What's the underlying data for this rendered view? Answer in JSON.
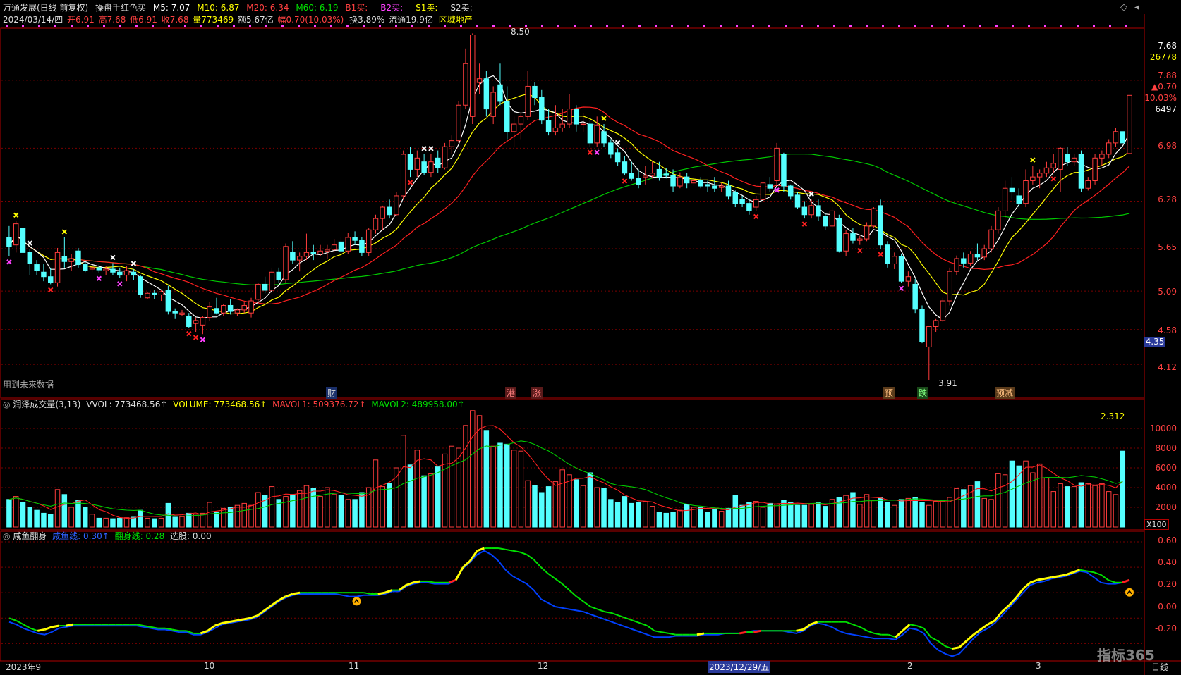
{
  "header": {
    "stock": "万通发展(日线 前复权)",
    "indicator": "操盘手红色买",
    "m5": "M5: 7.07",
    "m10": "M10: 6.87",
    "m20": "M20: 6.34",
    "m60": "M60: 6.19",
    "b1": "B1买: -",
    "b2": "B2买: -",
    "s1": "S1卖: -",
    "s2": "S2卖: -"
  },
  "info": {
    "date": "2024/03/14/四",
    "open": "开6.91",
    "high": "高7.68",
    "low": "低6.91",
    "close": "收7.68",
    "vol": "量773469",
    "amount": "额5.67亿",
    "change": "幅0.70(10.03%)",
    "turnover": "换3.89%",
    "float": "流通19.9亿",
    "sector": "区域地产"
  },
  "right_panel": {
    "close": "7.68",
    "volume": "26778",
    "price2": "7.88",
    "chg": "▲0.70",
    "pct": "10.03%",
    "num": "6497",
    "y_labels": [
      "6.98",
      "6.28",
      "5.65",
      "5.09",
      "4.58",
      "4.12"
    ],
    "current_tag": "4.35"
  },
  "main_annot": {
    "high_label": "8.50",
    "low_label": "3.91",
    "future_data": "用到未来数据"
  },
  "events": [
    "财",
    "港",
    "涨",
    "预",
    "跌",
    "预减"
  ],
  "vol_panel": {
    "title": "润泽成交量(3,13)",
    "vvol": "VVOL: 773468.56↑",
    "volume": "VOLUME: 773468.56↑",
    "mavol1": "MAVOL1: 509376.72↑",
    "mavol2": "MAVOL2: 489958.00↑",
    "value": "2.312",
    "y_labels": [
      "10000",
      "8000",
      "6000",
      "4000",
      "2000"
    ],
    "unit": "X100"
  },
  "ind_panel": {
    "title": "咸鱼翻身",
    "line1": "咸鱼线: 0.30↑",
    "line2": "翻身线: 0.28",
    "select": "选股: 0.00",
    "y_labels": [
      "0.60",
      "0.40",
      "0.20",
      "0.00",
      "-0.20"
    ]
  },
  "time_axis": {
    "labels": [
      "2023年9",
      "10",
      "11",
      "12",
      "2023/12/29/五",
      "2",
      "3"
    ],
    "period": "日线"
  },
  "watermark": "指标365",
  "colors": {
    "up": "#ff3c3c",
    "down": "#54ffff",
    "ma5": "#ffffff",
    "ma10": "#ffff00",
    "ma20": "#ff2020",
    "ma60": "#00c800",
    "grid": "#7a0000",
    "border": "#b00000",
    "blue": "#0040ff",
    "green": "#00e000",
    "yellow": "#ffff00",
    "red": "#ff2020"
  },
  "chart_data": {
    "type": "candlestick",
    "price_axis": [
      3.91,
      8.5
    ],
    "candles": [
      [
        5.8,
        5.95,
        5.55,
        5.68
      ],
      [
        5.7,
        6.02,
        5.6,
        5.98
      ],
      [
        5.92,
        6.0,
        5.55,
        5.6
      ],
      [
        5.6,
        5.65,
        5.3,
        5.45
      ],
      [
        5.44,
        5.5,
        5.3,
        5.36
      ],
      [
        5.34,
        5.45,
        5.22,
        5.28
      ],
      [
        5.28,
        5.4,
        5.18,
        5.2
      ],
      [
        5.2,
        5.66,
        5.15,
        5.6
      ],
      [
        5.55,
        5.8,
        5.4,
        5.48
      ],
      [
        5.48,
        5.58,
        5.36,
        5.52
      ],
      [
        5.62,
        5.66,
        5.4,
        5.44
      ],
      [
        5.44,
        5.5,
        5.34,
        5.36
      ],
      [
        5.38,
        5.44,
        5.34,
        5.4
      ],
      [
        5.4,
        5.44,
        5.33,
        5.37
      ],
      [
        5.36,
        5.42,
        5.3,
        5.38
      ],
      [
        5.38,
        5.46,
        5.3,
        5.34
      ],
      [
        5.34,
        5.4,
        5.26,
        5.3
      ],
      [
        5.3,
        5.42,
        5.22,
        5.36
      ],
      [
        5.34,
        5.38,
        5.24,
        5.3
      ],
      [
        5.28,
        5.3,
        5.0,
        5.04
      ],
      [
        5.0,
        5.08,
        4.98,
        5.06
      ],
      [
        5.06,
        5.1,
        4.98,
        5.04
      ],
      [
        5.04,
        5.1,
        4.96,
        5.08
      ],
      [
        5.1,
        5.16,
        4.78,
        4.82
      ],
      [
        4.82,
        4.86,
        4.72,
        4.8
      ],
      [
        4.78,
        4.84,
        4.76,
        4.8
      ],
      [
        4.76,
        4.8,
        4.6,
        4.62
      ],
      [
        4.66,
        4.74,
        4.55,
        4.7
      ],
      [
        4.64,
        4.76,
        4.52,
        4.74
      ],
      [
        4.74,
        4.95,
        4.7,
        4.88
      ],
      [
        4.86,
        5.0,
        4.78,
        4.8
      ],
      [
        4.8,
        4.92,
        4.76,
        4.9
      ],
      [
        4.9,
        4.98,
        4.78,
        4.82
      ],
      [
        4.8,
        4.86,
        4.76,
        4.84
      ],
      [
        4.84,
        4.94,
        4.8,
        4.9
      ],
      [
        4.8,
        5.0,
        4.74,
        4.96
      ],
      [
        4.98,
        5.2,
        4.94,
        5.18
      ],
      [
        5.18,
        5.28,
        5.06,
        5.1
      ],
      [
        5.1,
        5.4,
        5.05,
        5.34
      ],
      [
        5.34,
        5.4,
        5.2,
        5.24
      ],
      [
        5.24,
        5.72,
        5.2,
        5.68
      ],
      [
        5.6,
        5.75,
        5.45,
        5.5
      ],
      [
        5.5,
        5.6,
        5.35,
        5.55
      ],
      [
        5.55,
        5.85,
        5.5,
        5.6
      ],
      [
        5.6,
        5.7,
        5.5,
        5.58
      ],
      [
        5.58,
        5.7,
        5.55,
        5.62
      ],
      [
        5.62,
        5.7,
        5.52,
        5.64
      ],
      [
        5.64,
        5.78,
        5.6,
        5.7
      ],
      [
        5.74,
        5.8,
        5.58,
        5.62
      ],
      [
        5.62,
        5.86,
        5.58,
        5.8
      ],
      [
        5.8,
        5.88,
        5.7,
        5.76
      ],
      [
        5.76,
        5.8,
        5.55,
        5.6
      ],
      [
        5.6,
        5.92,
        5.55,
        5.9
      ],
      [
        5.9,
        6.1,
        5.85,
        6.05
      ],
      [
        6.05,
        6.22,
        5.9,
        6.2
      ],
      [
        6.2,
        6.3,
        6.05,
        6.1
      ],
      [
        6.1,
        6.4,
        6.08,
        6.35
      ],
      [
        6.35,
        6.95,
        6.3,
        6.9
      ],
      [
        6.9,
        7.0,
        6.6,
        6.7
      ],
      [
        6.7,
        6.95,
        6.6,
        6.85
      ],
      [
        6.8,
        6.9,
        6.62,
        6.66
      ],
      [
        6.66,
        6.9,
        6.6,
        6.8
      ],
      [
        6.85,
        6.95,
        6.65,
        6.72
      ],
      [
        6.72,
        7.05,
        6.7,
        7.0
      ],
      [
        7.0,
        7.15,
        6.9,
        7.08
      ],
      [
        7.08,
        7.6,
        7.05,
        7.55
      ],
      [
        7.55,
        8.3,
        7.5,
        8.1
      ],
      [
        7.4,
        8.5,
        7.3,
        8.48
      ],
      [
        7.85,
        8.1,
        7.7,
        7.9
      ],
      [
        7.9,
        8.0,
        7.4,
        7.5
      ],
      [
        7.4,
        7.8,
        7.3,
        7.72
      ],
      [
        7.82,
        8.1,
        7.55,
        7.6
      ],
      [
        7.6,
        7.8,
        7.1,
        7.2
      ],
      [
        7.2,
        7.4,
        7.0,
        7.3
      ],
      [
        7.3,
        7.45,
        7.1,
        7.4
      ],
      [
        7.4,
        8.0,
        7.35,
        7.8
      ],
      [
        7.8,
        7.85,
        7.55,
        7.65
      ],
      [
        7.65,
        7.75,
        7.3,
        7.35
      ],
      [
        7.35,
        7.5,
        7.15,
        7.2
      ],
      [
        7.2,
        7.55,
        7.15,
        7.25
      ],
      [
        7.25,
        7.5,
        7.2,
        7.3
      ],
      [
        7.3,
        7.7,
        7.25,
        7.5
      ],
      [
        7.5,
        7.55,
        7.2,
        7.3
      ],
      [
        7.3,
        7.45,
        7.2,
        7.3
      ],
      [
        7.3,
        7.35,
        7.0,
        7.05
      ],
      [
        7.05,
        7.4,
        7.0,
        7.28
      ],
      [
        7.2,
        7.3,
        7.0,
        7.05
      ],
      [
        7.05,
        7.1,
        6.85,
        6.9
      ],
      [
        6.92,
        6.98,
        6.75,
        6.8
      ],
      [
        6.8,
        6.88,
        6.62,
        6.65
      ],
      [
        6.65,
        6.8,
        6.55,
        6.58
      ],
      [
        6.58,
        6.7,
        6.45,
        6.5
      ],
      [
        6.6,
        6.75,
        6.5,
        6.62
      ],
      [
        6.62,
        6.8,
        6.58,
        6.65
      ],
      [
        6.7,
        6.8,
        6.55,
        6.6
      ],
      [
        6.64,
        6.72,
        6.58,
        6.62
      ],
      [
        6.62,
        6.7,
        6.4,
        6.48
      ],
      [
        6.48,
        6.66,
        6.45,
        6.6
      ],
      [
        6.6,
        6.65,
        6.45,
        6.52
      ],
      [
        6.52,
        6.6,
        6.48,
        6.55
      ],
      [
        6.55,
        6.6,
        6.45,
        6.48
      ],
      [
        6.5,
        6.55,
        6.4,
        6.48
      ],
      [
        6.48,
        6.6,
        6.4,
        6.45
      ],
      [
        6.46,
        6.52,
        6.4,
        6.48
      ],
      [
        6.48,
        6.55,
        6.3,
        6.35
      ],
      [
        6.4,
        6.42,
        6.2,
        6.25
      ],
      [
        6.3,
        6.35,
        6.2,
        6.25
      ],
      [
        6.25,
        6.3,
        6.1,
        6.15
      ],
      [
        6.2,
        6.35,
        6.15,
        6.3
      ],
      [
        6.3,
        6.55,
        6.28,
        6.52
      ],
      [
        6.5,
        6.6,
        6.4,
        6.45
      ],
      [
        6.55,
        7.05,
        6.5,
        6.98
      ],
      [
        6.9,
        6.92,
        6.4,
        6.48
      ],
      [
        6.48,
        6.5,
        6.3,
        6.35
      ],
      [
        6.36,
        6.4,
        6.18,
        6.2
      ],
      [
        6.2,
        6.28,
        6.05,
        6.1
      ],
      [
        6.1,
        6.3,
        6.05,
        6.22
      ],
      [
        6.22,
        6.3,
        6.02,
        6.08
      ],
      [
        6.08,
        6.12,
        5.9,
        5.95
      ],
      [
        5.95,
        6.2,
        5.92,
        6.15
      ],
      [
        6.05,
        6.1,
        5.6,
        5.62
      ],
      [
        5.62,
        5.9,
        5.55,
        5.85
      ],
      [
        5.85,
        5.92,
        5.72,
        5.76
      ],
      [
        5.76,
        5.82,
        5.7,
        5.78
      ],
      [
        5.78,
        6.0,
        5.75,
        5.95
      ],
      [
        5.95,
        6.2,
        5.92,
        6.18
      ],
      [
        6.22,
        6.3,
        5.65,
        5.7
      ],
      [
        5.7,
        5.75,
        5.4,
        5.45
      ],
      [
        5.45,
        5.6,
        5.38,
        5.55
      ],
      [
        5.55,
        5.58,
        5.2,
        5.22
      ],
      [
        5.22,
        5.35,
        5.15,
        5.28
      ],
      [
        5.18,
        5.25,
        4.8,
        4.85
      ],
      [
        4.85,
        4.9,
        4.4,
        4.42
      ],
      [
        4.35,
        4.6,
        3.91,
        4.62
      ],
      [
        4.62,
        4.72,
        4.55,
        4.7
      ],
      [
        4.7,
        5.0,
        4.68,
        4.96
      ],
      [
        4.96,
        5.4,
        4.9,
        5.35
      ],
      [
        5.35,
        5.56,
        5.3,
        5.52
      ],
      [
        5.52,
        5.6,
        5.4,
        5.46
      ],
      [
        5.46,
        5.62,
        5.42,
        5.58
      ],
      [
        5.58,
        5.72,
        5.5,
        5.54
      ],
      [
        5.54,
        5.7,
        5.5,
        5.65
      ],
      [
        5.65,
        5.95,
        5.6,
        5.9
      ],
      [
        5.9,
        6.2,
        5.85,
        6.15
      ],
      [
        6.15,
        6.55,
        6.05,
        6.45
      ],
      [
        6.45,
        6.6,
        6.3,
        6.4
      ],
      [
        6.35,
        6.45,
        6.2,
        6.25
      ],
      [
        6.25,
        6.7,
        6.2,
        6.55
      ],
      [
        6.55,
        6.75,
        6.5,
        6.6
      ],
      [
        6.6,
        6.7,
        6.45,
        6.65
      ],
      [
        6.65,
        6.8,
        6.6,
        6.72
      ],
      [
        6.72,
        6.9,
        6.65,
        6.78
      ],
      [
        6.7,
        7.0,
        6.4,
        6.98
      ],
      [
        6.9,
        7.0,
        6.75,
        6.8
      ],
      [
        6.8,
        6.9,
        6.75,
        6.85
      ],
      [
        6.9,
        6.95,
        6.4,
        6.45
      ],
      [
        6.45,
        6.6,
        6.42,
        6.55
      ],
      [
        6.55,
        6.9,
        6.5,
        6.85
      ],
      [
        6.85,
        6.95,
        6.75,
        6.9
      ],
      [
        6.9,
        7.1,
        6.85,
        7.05
      ],
      [
        7.05,
        7.25,
        7.0,
        7.2
      ],
      [
        7.2,
        7.1,
        7.08,
        7.05
      ],
      [
        6.91,
        7.68,
        6.91,
        7.68
      ]
    ],
    "volumes": [
      2800,
      3100,
      2500,
      2000,
      1700,
      1400,
      1300,
      3800,
      3300,
      2000,
      2700,
      2000,
      1300,
      900,
      900,
      850,
      900,
      950,
      1000,
      1700,
      900,
      850,
      900,
      2400,
      1000,
      1050,
      1400,
      1300,
      1400,
      2500,
      1500,
      1900,
      2000,
      2200,
      2400,
      2200,
      3500,
      3200,
      4100,
      2800,
      3100,
      3300,
      3700,
      4200,
      3900,
      3100,
      4000,
      3300,
      3200,
      2800,
      2800,
      3500,
      4000,
      6800,
      4100,
      4400,
      6000,
      9300,
      6300,
      7800,
      5200,
      5400,
      6100,
      7400,
      8200,
      8000,
      10300,
      11800,
      11300,
      9800,
      8200,
      8500,
      8400,
      7800,
      7700,
      4700,
      4200,
      3500,
      4100,
      4600,
      5800,
      5300,
      4800,
      4200,
      5500,
      4000,
      3900,
      2800,
      2500,
      3100,
      2400,
      2500,
      2600,
      2100,
      1500,
      1400,
      1500,
      1700,
      2300,
      2000,
      2000,
      1500,
      1800,
      1600,
      1900,
      3200,
      2200,
      2500,
      2600,
      2000,
      2400,
      2300,
      2700,
      2500,
      2200,
      2200,
      2300,
      2500,
      2100,
      2800,
      3000,
      3200,
      3500,
      2300,
      3300,
      2700,
      3000,
      2500,
      2200,
      2800,
      2900,
      3000,
      2500,
      2200,
      2600,
      2600,
      3000,
      3900,
      3800,
      4200,
      4600,
      2900,
      2800,
      5400,
      5300,
      6700,
      6200,
      6700,
      5500,
      6400,
      5000,
      3600,
      4400,
      4100,
      4100,
      4500,
      4400,
      4200,
      4400,
      3600,
      3300,
      7700
    ],
    "ind_yellow": [
      0,
      -0.02,
      -0.05,
      -0.08,
      -0.1,
      -0.09,
      -0.07,
      -0.06,
      -0.06,
      -0.05,
      -0.05,
      -0.05,
      -0.05,
      -0.05,
      -0.05,
      -0.05,
      -0.05,
      -0.05,
      -0.05,
      -0.06,
      -0.07,
      -0.08,
      -0.08,
      -0.09,
      -0.1,
      -0.1,
      -0.12,
      -0.12,
      -0.1,
      -0.06,
      -0.04,
      -0.03,
      -0.02,
      -0.01,
      0.0,
      0.02,
      0.06,
      0.1,
      0.14,
      0.17,
      0.19,
      0.2,
      0.2,
      0.2,
      0.2,
      0.2,
      0.2,
      0.2,
      0.2,
      0.2,
      0.2,
      0.19,
      0.19,
      0.2,
      0.22,
      0.22,
      0.26,
      0.28,
      0.29,
      0.29,
      0.28,
      0.28,
      0.28,
      0.3,
      0.4,
      0.45,
      0.53,
      0.55,
      0.55,
      0.55,
      0.54,
      0.53,
      0.52,
      0.5,
      0.46,
      0.4,
      0.35,
      0.31,
      0.27,
      0.22,
      0.17,
      0.13,
      0.09,
      0.07,
      0.05,
      0.04,
      0.02,
      0.0,
      -0.02,
      -0.04,
      -0.06,
      -0.1,
      -0.11,
      -0.12,
      -0.13,
      -0.13,
      -0.13,
      -0.13,
      -0.12,
      -0.12,
      -0.12,
      -0.12,
      -0.12,
      -0.12,
      -0.11,
      -0.11,
      -0.1,
      -0.1,
      -0.1,
      -0.1,
      -0.1,
      -0.1,
      -0.09,
      -0.05,
      -0.03,
      -0.03,
      -0.03,
      -0.03,
      -0.03,
      -0.05,
      -0.07,
      -0.1,
      -0.12,
      -0.13,
      -0.13,
      -0.15,
      -0.1,
      -0.05,
      -0.06,
      -0.08,
      -0.15,
      -0.18,
      -0.22,
      -0.24,
      -0.23,
      -0.18,
      -0.13,
      -0.09,
      -0.05,
      -0.02,
      0.05,
      0.1,
      0.16,
      0.23,
      0.28,
      0.3,
      0.31,
      0.32,
      0.33,
      0.34,
      0.36,
      0.38,
      0.37,
      0.36,
      0.34,
      0.3,
      0.28,
      0.28,
      0.3
    ],
    "ind_blue": [
      -0.03,
      -0.05,
      -0.08,
      -0.1,
      -0.12,
      -0.13,
      -0.11,
      -0.08,
      -0.07,
      -0.06,
      -0.06,
      -0.06,
      -0.06,
      -0.06,
      -0.06,
      -0.06,
      -0.06,
      -0.06,
      -0.06,
      -0.07,
      -0.08,
      -0.09,
      -0.09,
      -0.1,
      -0.11,
      -0.11,
      -0.13,
      -0.13,
      -0.11,
      -0.08,
      -0.05,
      -0.04,
      -0.03,
      -0.02,
      -0.01,
      0.01,
      0.05,
      0.09,
      0.13,
      0.16,
      0.18,
      0.19,
      0.19,
      0.19,
      0.19,
      0.19,
      0.19,
      0.18,
      0.17,
      0.17,
      0.18,
      0.18,
      0.18,
      0.19,
      0.21,
      0.21,
      0.25,
      0.27,
      0.28,
      0.28,
      0.27,
      0.27,
      0.27,
      0.3,
      0.39,
      0.44,
      0.5,
      0.53,
      0.5,
      0.45,
      0.38,
      0.33,
      0.3,
      0.27,
      0.22,
      0.15,
      0.12,
      0.09,
      0.08,
      0.07,
      0.06,
      0.05,
      0.03,
      0.01,
      -0.01,
      -0.03,
      -0.05,
      -0.07,
      -0.09,
      -0.11,
      -0.13,
      -0.15,
      -0.15,
      -0.15,
      -0.14,
      -0.14,
      -0.14,
      -0.14,
      -0.13,
      -0.13,
      -0.13,
      -0.12,
      -0.12,
      -0.12,
      -0.11,
      -0.1,
      -0.1,
      -0.1,
      -0.1,
      -0.1,
      -0.11,
      -0.12,
      -0.1,
      -0.06,
      -0.04,
      -0.05,
      -0.07,
      -0.1,
      -0.12,
      -0.13,
      -0.14,
      -0.15,
      -0.16,
      -0.16,
      -0.16,
      -0.17,
      -0.13,
      -0.08,
      -0.09,
      -0.12,
      -0.2,
      -0.25,
      -0.28,
      -0.3,
      -0.28,
      -0.22,
      -0.16,
      -0.11,
      -0.08,
      -0.04,
      0.02,
      0.08,
      0.14,
      0.2,
      0.26,
      0.28,
      0.29,
      0.31,
      0.32,
      0.33,
      0.35,
      0.37,
      0.36,
      0.32,
      0.28,
      0.27,
      0.27,
      0.28,
      0.3
    ]
  }
}
